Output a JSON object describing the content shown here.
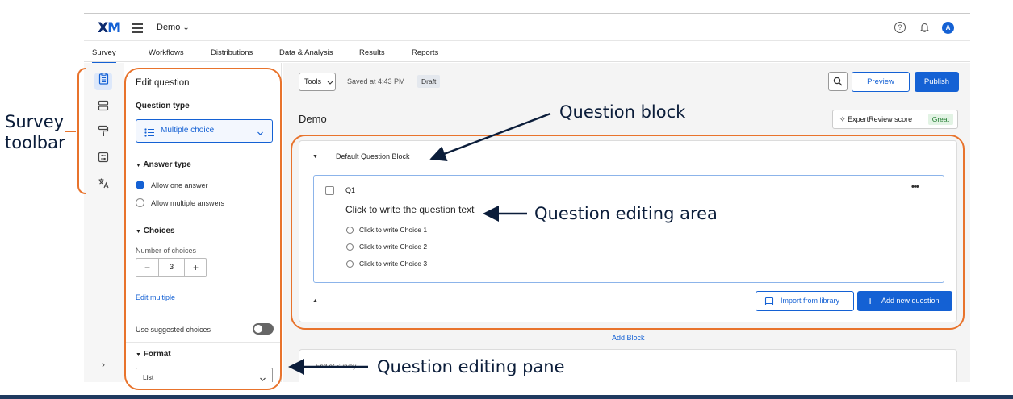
{
  "annotations": {
    "survey_toolbar_line1": "Survey",
    "survey_toolbar_line2": "toolbar",
    "question_block": "Question block",
    "question_editing_area": "Question editing area",
    "question_editing_pane": "Question editing pane",
    "accent_color": "#e8732c",
    "arrow_color": "#0b1d3a"
  },
  "topbar": {
    "logo_x": "X",
    "logo_m": "M",
    "project_name": "Demo",
    "project_chevron": "⌄",
    "help_icon": "?",
    "bell_icon": "bell-icon",
    "avatar_letter": "A"
  },
  "tabs": [
    "Survey",
    "Workflows",
    "Distributions",
    "Data & Analysis",
    "Results",
    "Reports"
  ],
  "edit_pane": {
    "title": "Edit question",
    "question_type_heading": "Question type",
    "question_type_value": "Multiple choice",
    "answer_type_heading": "Answer type",
    "answer_options": [
      "Allow one answer",
      "Allow multiple answers"
    ],
    "selected_answer": "Allow one answer",
    "choices_heading": "Choices",
    "number_of_choices_label": "Number of choices",
    "stepper_minus": "−",
    "number_of_choices": "3",
    "stepper_plus": "+",
    "edit_multiple_link": "Edit multiple",
    "suggested_choices_label": "Use suggested choices",
    "format_heading": "Format",
    "format_value": "List"
  },
  "main": {
    "tools_label": "Tools",
    "saved_text": "Saved at 4:43 PM",
    "draft_badge": "Draft",
    "preview_label": "Preview",
    "publish_label": "Publish",
    "survey_title": "Demo",
    "expert_review_label": "ExpertReview score",
    "expert_review_value": "Great",
    "block_name": "Default Question Block",
    "question_id": "Q1",
    "question_text": "Click to write the question text",
    "choices": [
      "Click to write Choice 1",
      "Click to write Choice 2",
      "Click to write Choice 3"
    ],
    "more_icon": "•••",
    "import_label": "Import from library",
    "add_question_label": "Add new question",
    "add_block_label": "Add Block",
    "end_of_survey": "End of Survey"
  },
  "colors": {
    "brand_blue": "#1461d4",
    "logo_navy": "#0b2a6f"
  }
}
